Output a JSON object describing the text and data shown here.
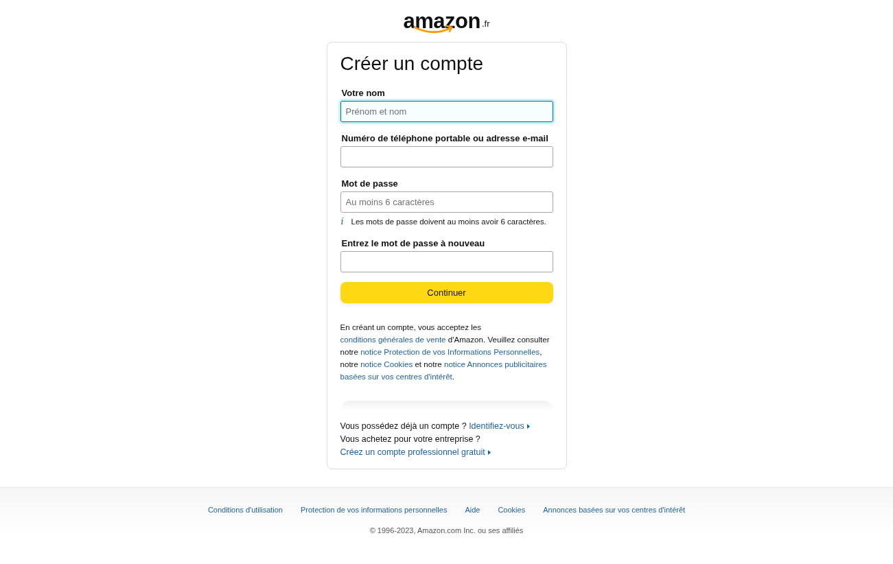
{
  "logo": {
    "wordmark": "amazon",
    "suffix": ".fr"
  },
  "form": {
    "title": "Créer un compte",
    "fields": [
      {
        "label": "Votre nom",
        "placeholder": "Prénom et nom",
        "focused": true
      },
      {
        "label": "Numéro de téléphone portable ou adresse e-mail",
        "focused": false
      },
      {
        "label": "Mot de passe",
        "placeholder": "Au moins 6 caractères",
        "focused": false,
        "hint_icon": "i",
        "hint": "Les mots de passe doivent au moins avoir 6 caractères."
      },
      {
        "label": "Entrez le mot de passe à nouveau",
        "focused": false
      }
    ],
    "submit": "Continuer",
    "legal": [
      {
        "kind": "text",
        "text": "En créant un compte, vous acceptez les "
      },
      {
        "kind": "link",
        "text": "conditions générales de vente"
      },
      {
        "kind": "text",
        "text": " d'Amazon. Veuillez consulter notre "
      },
      {
        "kind": "link",
        "text": "notice Protection de vos Informations Personnelles"
      },
      {
        "kind": "text",
        "text": ", notre "
      },
      {
        "kind": "link",
        "text": "notice Cookies"
      },
      {
        "kind": "text",
        "text": " et notre "
      },
      {
        "kind": "link",
        "text": "notice Annonces publicitaires"
      },
      {
        "kind": "link",
        "text": "basées sur vos centres d'intérêt"
      },
      {
        "kind": "text",
        "text": "."
      }
    ],
    "prompts": [
      {
        "text": "Vous possédez déjà un compte ?",
        "link": "Identifiez-vous"
      },
      {
        "text": "Vous achetez pour votre entreprise ?",
        "link": "Créez un compte professionnel gratuit"
      }
    ]
  },
  "footer": {
    "links": [
      "Conditions d'utilisation",
      "Protection de vos informations personnelles",
      "Aide",
      "Cookies",
      "Annonces basées sur vos centres d'intérêt"
    ],
    "copyright": "© 1996-2023, Amazon.com Inc. ou ses affiliés"
  }
}
